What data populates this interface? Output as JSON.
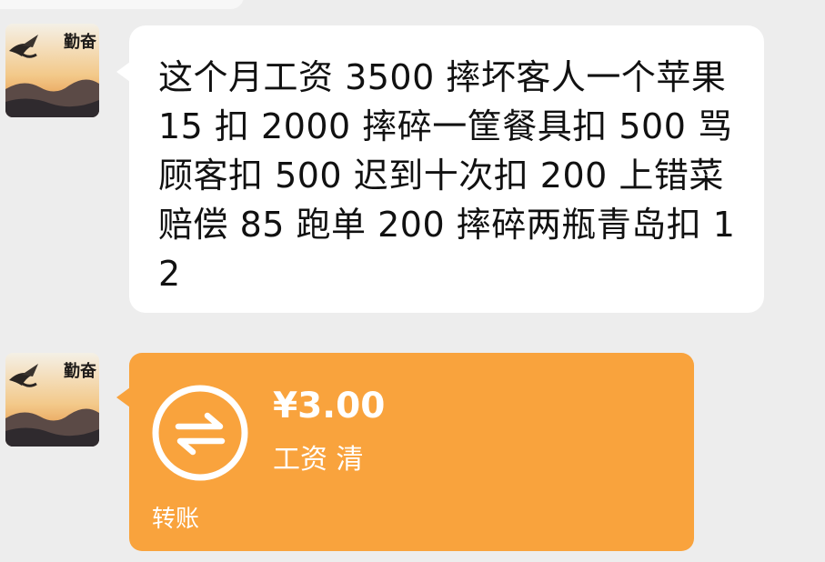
{
  "messages": [
    {
      "sender_avatar": {
        "icon": "eagle-landscape-avatar-icon",
        "caption": "勤奋"
      },
      "text": "这个月工资 3500 摔坏客人一个苹果 15 扣 2000 摔碎一筐餐具扣 500 骂顾客扣 500 迟到十次扣 200 上错菜赔偿 85 跑单 200 摔碎两瓶青岛扣 12"
    },
    {
      "sender_avatar": {
        "icon": "eagle-landscape-avatar-icon",
        "caption": "勤奋"
      },
      "transfer": {
        "icon": "transfer-arrows-icon",
        "amount": "¥3.00",
        "note": "工资 清",
        "label": "转账",
        "color": "#f9a33d"
      }
    }
  ],
  "colors": {
    "background": "#ededed",
    "text_bubble": "#ffffff",
    "transfer_bubble": "#f9a33d"
  }
}
